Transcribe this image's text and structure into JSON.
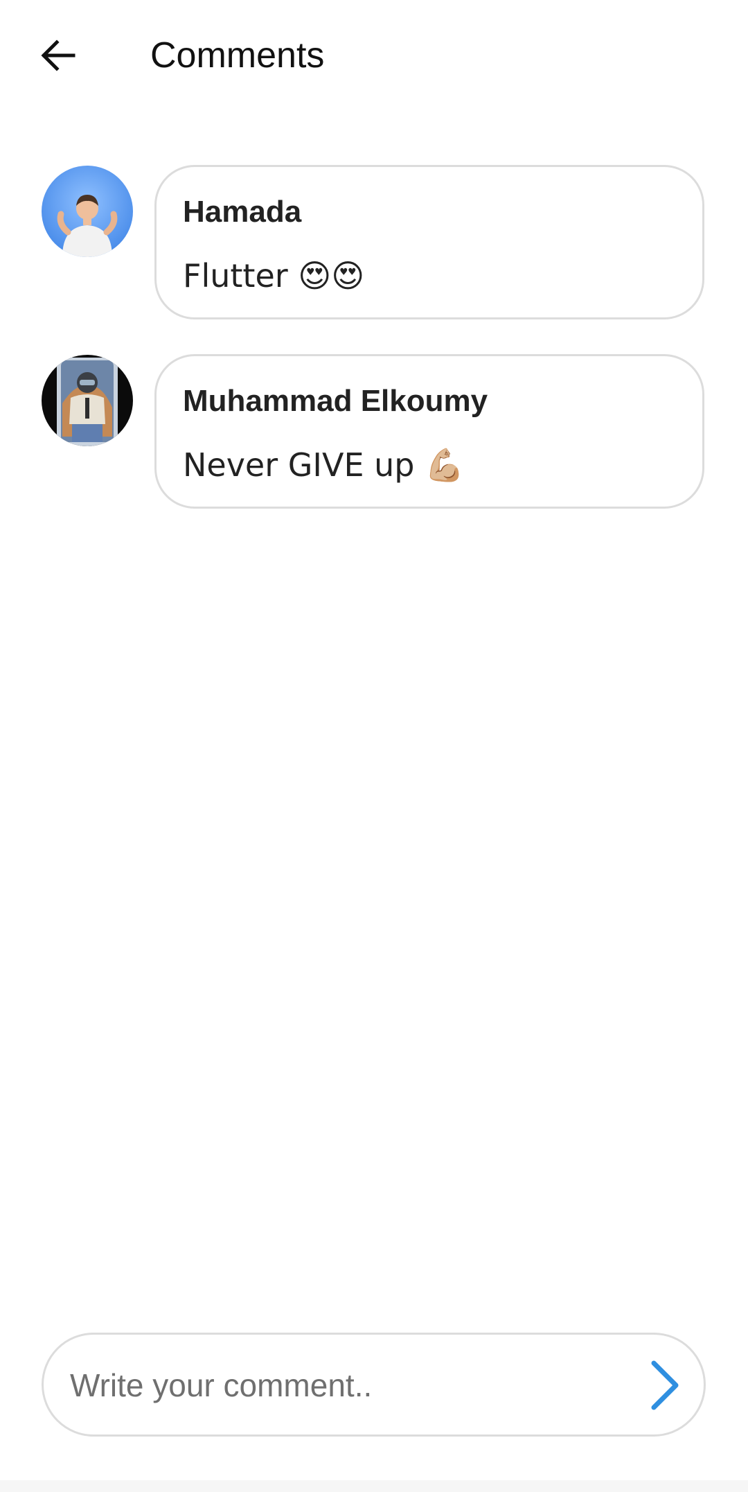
{
  "app_bar": {
    "title": "Comments",
    "back_icon": "arrow-back-icon"
  },
  "comments": [
    {
      "author": "Hamada",
      "text": "Flutter 😍😍",
      "avatar_icon": "avatar-photo-icon"
    },
    {
      "author": "Muhammad Elkoumy",
      "text": "Never GIVE up 💪🏼",
      "avatar_icon": "avatar-photo-icon"
    }
  ],
  "composer": {
    "placeholder": "Write your comment..",
    "value": "",
    "send_icon": "chevron-right-icon"
  },
  "colors": {
    "background": "#ffffff",
    "border": "#dcdcdc",
    "accent": "#2f8fe0",
    "text": "#222222"
  }
}
